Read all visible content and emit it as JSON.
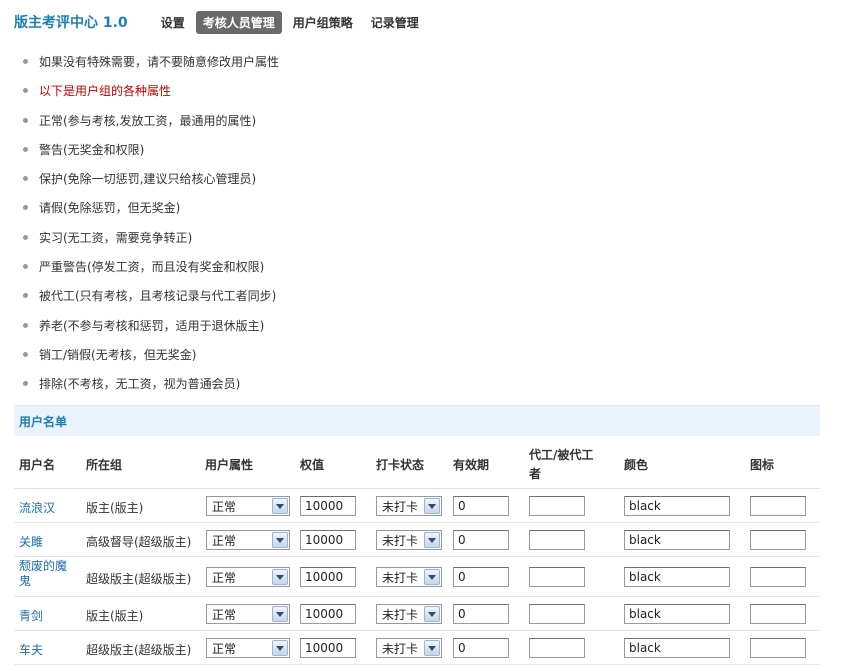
{
  "header": {
    "title": "版主考评中心 1.0",
    "nav": [
      {
        "label": "设置",
        "active": false
      },
      {
        "label": "考核人员管理",
        "active": true
      },
      {
        "label": "用户组策略",
        "active": false
      },
      {
        "label": "记录管理",
        "active": false
      }
    ]
  },
  "notes": [
    {
      "text": "如果没有特殊需要，请不要随意修改用户属性",
      "highlight": false
    },
    {
      "text": "以下是用户组的各种属性",
      "highlight": true
    },
    {
      "text": "正常(参与考核,发放工资，最通用的属性)",
      "highlight": false
    },
    {
      "text": "警告(无奖金和权限)",
      "highlight": false
    },
    {
      "text": "保护(免除一切惩罚,建议只给核心管理员)",
      "highlight": false
    },
    {
      "text": "请假(免除惩罚，但无奖金)",
      "highlight": false
    },
    {
      "text": "实习(无工资，需要竞争转正)",
      "highlight": false
    },
    {
      "text": "严重警告(停发工资，而且没有奖金和权限)",
      "highlight": false
    },
    {
      "text": "被代工(只有考核，且考核记录与代工者同步)",
      "highlight": false
    },
    {
      "text": "养老(不参与考核和惩罚，适用于退休版主)",
      "highlight": false
    },
    {
      "text": "销工/销假(无考核，但无奖金)",
      "highlight": false
    },
    {
      "text": "排除(不考核，无工资，视为普通会员)",
      "highlight": false
    }
  ],
  "section": {
    "title": "用户名单"
  },
  "table": {
    "columns": {
      "username": "用户名",
      "group": "所在组",
      "attribute": "用户属性",
      "weight": "权值",
      "checkin": "打卡状态",
      "validity": "有效期",
      "substitute_line1": "代工/被代工",
      "substitute_line2": "者",
      "color": "颜色",
      "icon": "图标"
    },
    "rows": [
      {
        "username": "流浪汉",
        "group": "版主(版主)",
        "attribute": "正常",
        "weight": "10000",
        "checkin": "未打卡",
        "validity": "0",
        "substitute": "",
        "color": "black",
        "icon": ""
      },
      {
        "username": "关雎",
        "group": "高级督导(超级版主)",
        "attribute": "正常",
        "weight": "10000",
        "checkin": "未打卡",
        "validity": "0",
        "substitute": "",
        "color": "black",
        "icon": ""
      },
      {
        "username": "颓废的魔鬼",
        "group": "超级版主(超级版主)",
        "attribute": "正常",
        "weight": "10000",
        "checkin": "未打卡",
        "validity": "0",
        "substitute": "",
        "color": "black",
        "icon": ""
      },
      {
        "username": "青剑",
        "group": "版主(版主)",
        "attribute": "正常",
        "weight": "10000",
        "checkin": "未打卡",
        "validity": "0",
        "substitute": "",
        "color": "black",
        "icon": ""
      },
      {
        "username": "车夫",
        "group": "超级版主(超级版主)",
        "attribute": "正常",
        "weight": "10000",
        "checkin": "未打卡",
        "validity": "0",
        "substitute": "",
        "color": "black",
        "icon": ""
      }
    ]
  }
}
